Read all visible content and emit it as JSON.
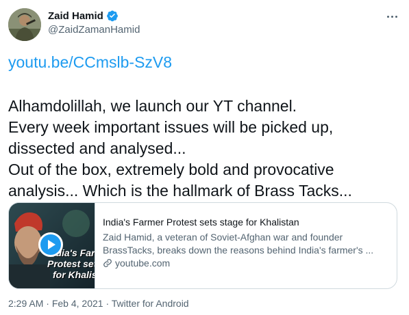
{
  "author": {
    "name": "Zaid Hamid",
    "handle": "@ZaidZamanHamid",
    "verified_icon": "verified-badge-icon"
  },
  "tweet": {
    "link_text": "youtu.be/CCmslb-SzV8",
    "lines": [
      "Alhamdolillah, we launch our  YT channel.",
      "Every week important issues will be picked up,",
      "dissected and analysed...",
      "Out of the box, extremely bold and provocative",
      "analysis... Which is the hallmark of Brass Tacks..."
    ]
  },
  "card": {
    "thumbnail_text_lines": [
      "India's Far",
      "Protest sets",
      "for Khalis"
    ],
    "title": "India's Farmer Protest sets stage for Khalistan",
    "description_lines": [
      "Zaid Hamid, a veteran of Soviet-Afghan war and founder",
      "BrassTacks, breaks down the reasons behind India's farmer's ..."
    ],
    "domain": "youtube.com",
    "play_icon": "play-icon"
  },
  "meta": {
    "time": "2:29 AM",
    "separator": " · ",
    "date": "Feb 4, 2021",
    "source": "Twitter for Android"
  },
  "colors": {
    "accent": "#1d9bf0",
    "text": "#0f1419",
    "secondary": "#536471",
    "border": "#cfd9de"
  }
}
